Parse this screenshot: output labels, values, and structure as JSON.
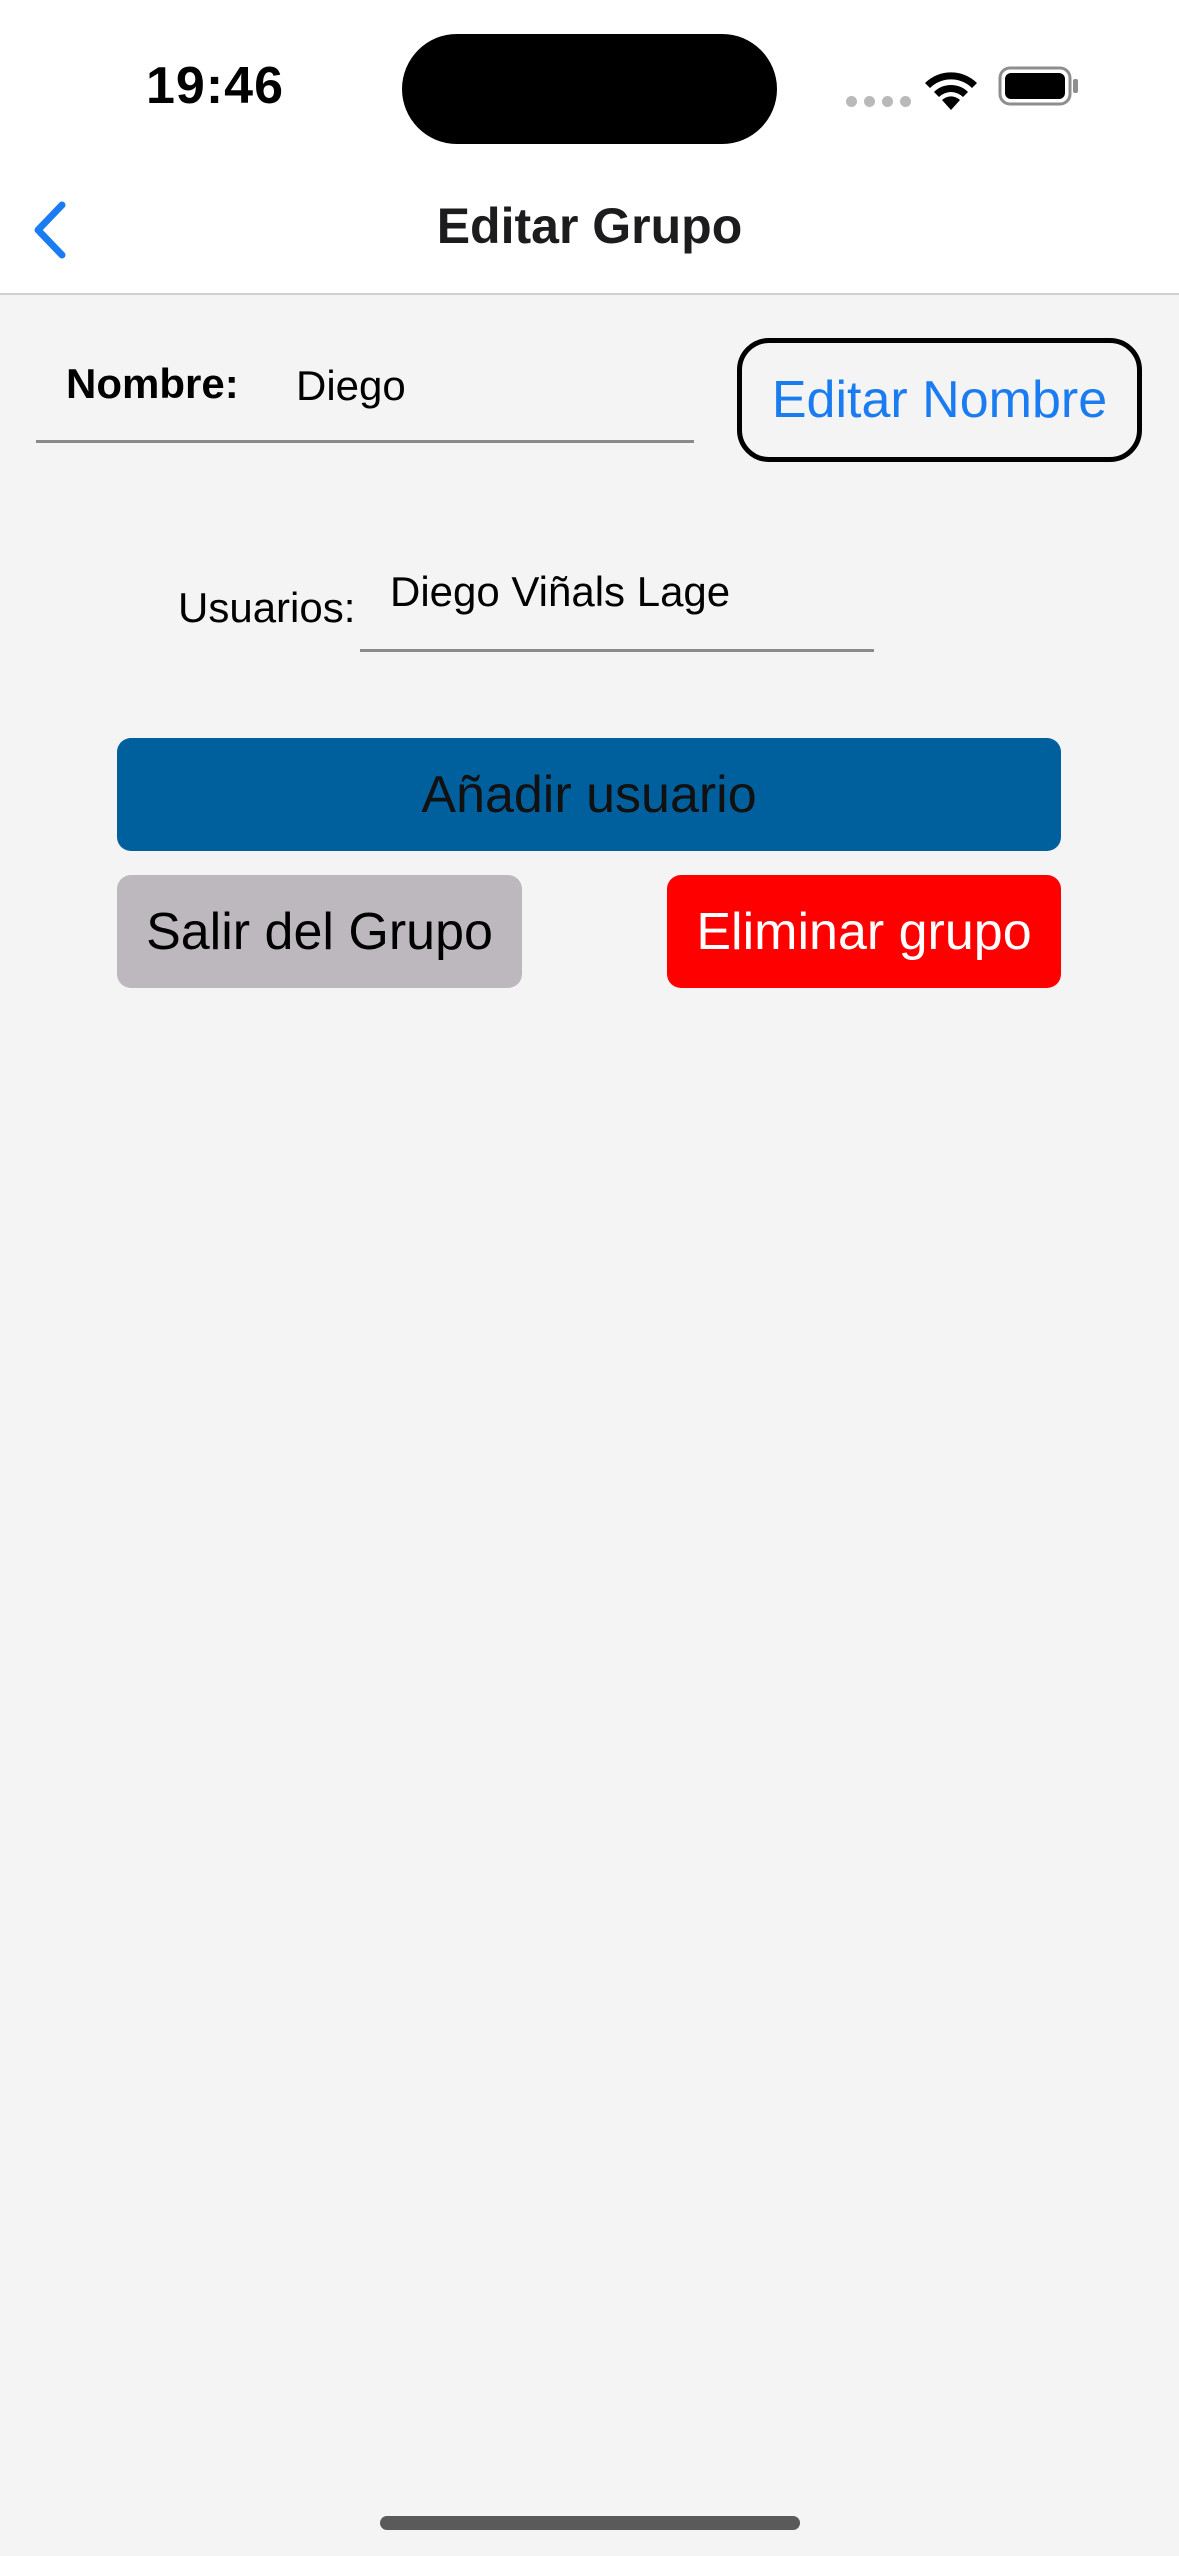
{
  "status_bar": {
    "time": "19:46",
    "icons": [
      "signal-dots-icon",
      "wifi-icon",
      "battery-icon"
    ]
  },
  "nav": {
    "title": "Editar Grupo",
    "back_icon": "chevron-left-icon"
  },
  "form": {
    "name_label": "Nombre:",
    "name_value": "Diego",
    "edit_name_label": "Editar Nombre",
    "users_label": "Usuarios:",
    "users_value": "Diego Viñals Lage"
  },
  "actions": {
    "add_user_label": "Añadir usuario",
    "leave_group_label": "Salir del Grupo",
    "delete_group_label": "Eliminar grupo"
  },
  "colors": {
    "accent": "#1a7cf0",
    "add_user_bg": "#005f9d",
    "leave_group_bg": "#bdb8bd",
    "delete_group_bg": "#ff0000",
    "background": "#f4f4f4"
  }
}
